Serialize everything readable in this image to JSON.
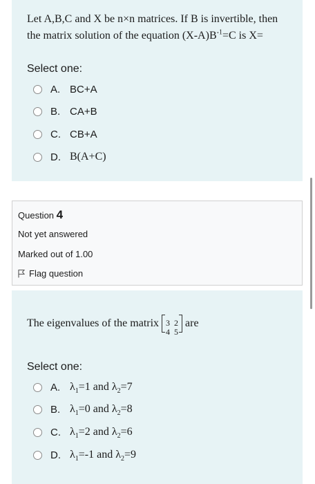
{
  "q1": {
    "text_part1": "Let A,B,C and X be n×n matrices. If B is invertible, then the matrix solution of the equation (X-A)B",
    "text_sup": "-1",
    "text_part2": "=C is X=",
    "prompt": "Select one:",
    "options": [
      {
        "letter": "A.",
        "text": "BC+A"
      },
      {
        "letter": "B.",
        "text": "CA+B"
      },
      {
        "letter": "C.",
        "text": "CB+A"
      },
      {
        "letter": "D.",
        "text": "B(A+C)"
      }
    ]
  },
  "info": {
    "question_label": "Question",
    "question_number": "4",
    "status": "Not yet answered",
    "marks": "Marked out of 1.00",
    "flag_label": "Flag question"
  },
  "q2": {
    "text_before": "The eigenvalues of the matrix",
    "matrix": [
      "3",
      "2",
      "4",
      "5"
    ],
    "text_after": "are",
    "prompt": "Select one:",
    "options": [
      {
        "letter": "A.",
        "l1": "λ",
        "s1": "1",
        "v1": "=1 and ",
        "l2": "λ",
        "s2": "2",
        "v2": "=7"
      },
      {
        "letter": "B.",
        "l1": "λ",
        "s1": "1",
        "v1": "=0 and ",
        "l2": "λ",
        "s2": "2",
        "v2": "=8"
      },
      {
        "letter": "C.",
        "l1": "λ",
        "s1": "1",
        "v1": "=2 and ",
        "l2": "λ",
        "s2": "2",
        "v2": "=6"
      },
      {
        "letter": "D.",
        "l1": "λ",
        "s1": "1",
        "v1": "=-1 and ",
        "l2": "λ",
        "s2": "2",
        "v2": "=9"
      }
    ]
  }
}
